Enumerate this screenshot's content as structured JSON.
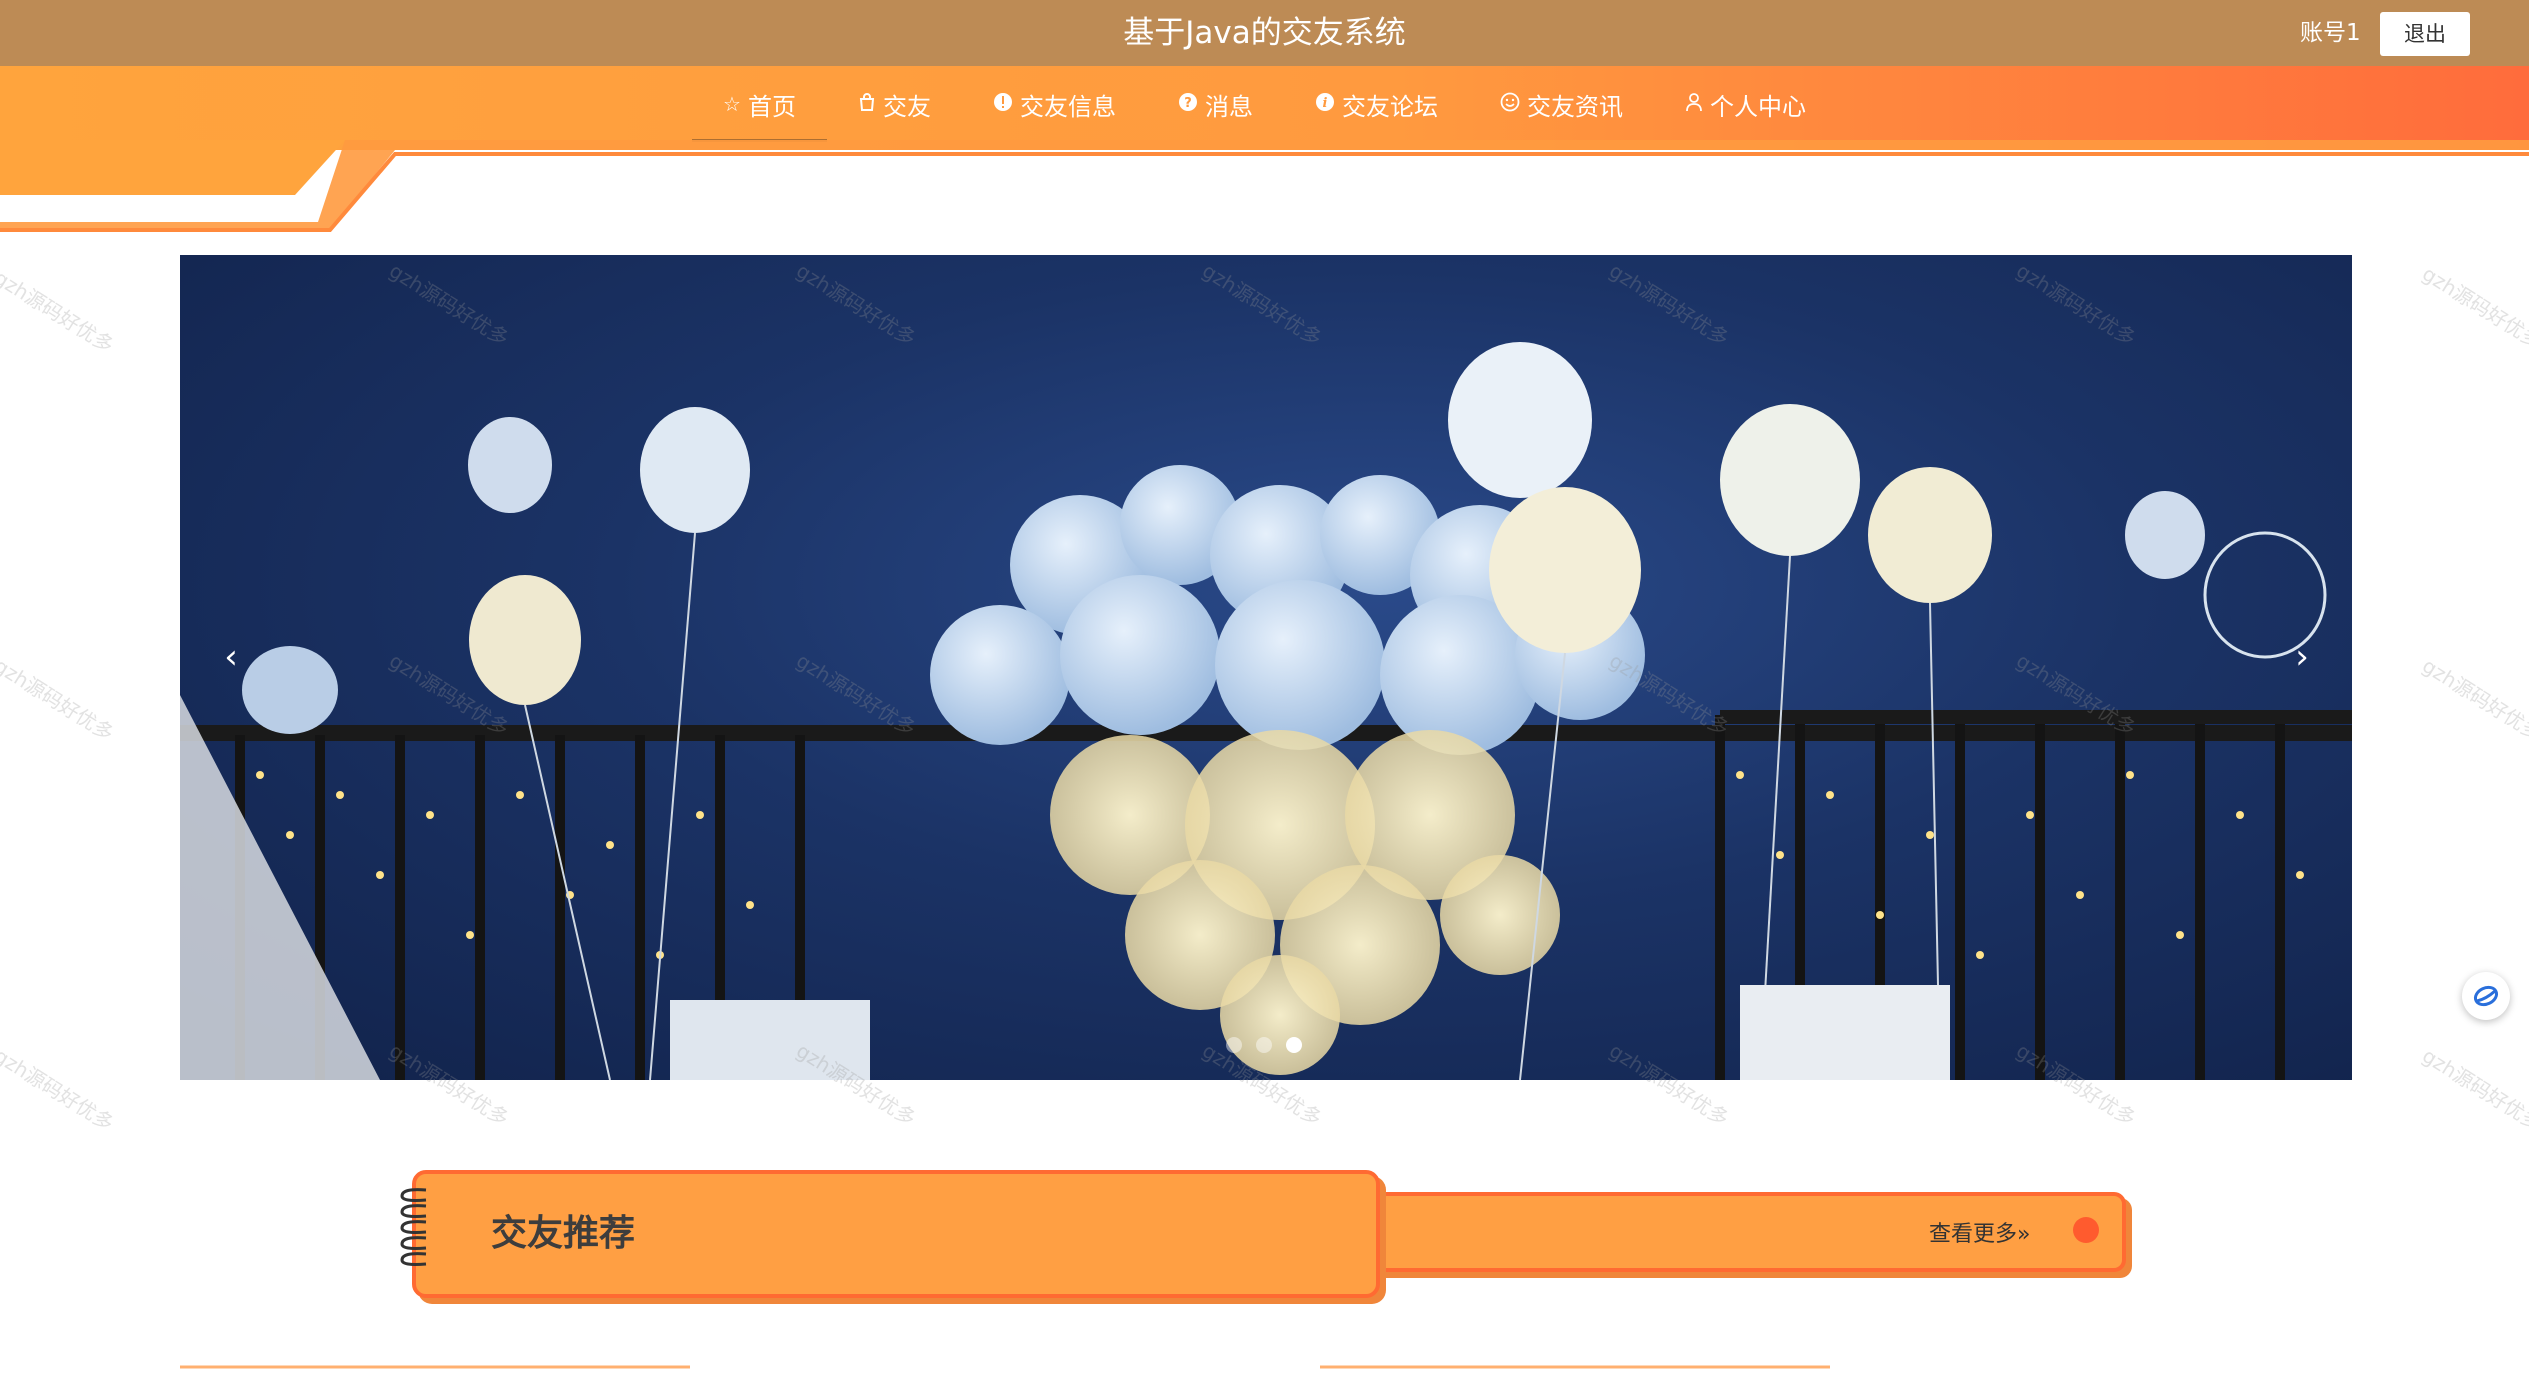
{
  "header": {
    "title": "基于Java的交友系统",
    "account": "账号1",
    "logout_label": "退出"
  },
  "nav": {
    "items": [
      {
        "label": "首页",
        "icon": "star-icon",
        "active": true
      },
      {
        "label": "交友",
        "icon": "bag-icon"
      },
      {
        "label": "交友信息",
        "icon": "exclamation-icon"
      },
      {
        "label": "消息",
        "icon": "question-icon"
      },
      {
        "label": "交友论坛",
        "icon": "info-icon"
      },
      {
        "label": "交友资讯",
        "icon": "smile-icon"
      },
      {
        "label": "个人中心",
        "icon": "user-icon"
      }
    ]
  },
  "banner": {
    "prev": "‹",
    "next": "›",
    "slide_count": 3,
    "active_slide": 3
  },
  "section": {
    "title": "交友推荐",
    "more_label": "查看更多»"
  },
  "watermark": "gzh源码好优多",
  "colors": {
    "topbar": "#bd8b55",
    "nav_start": "#ffa43d",
    "nav_end": "#ff6c3c",
    "section_fill": "#ff9f43",
    "section_border": "#ff6a32"
  }
}
